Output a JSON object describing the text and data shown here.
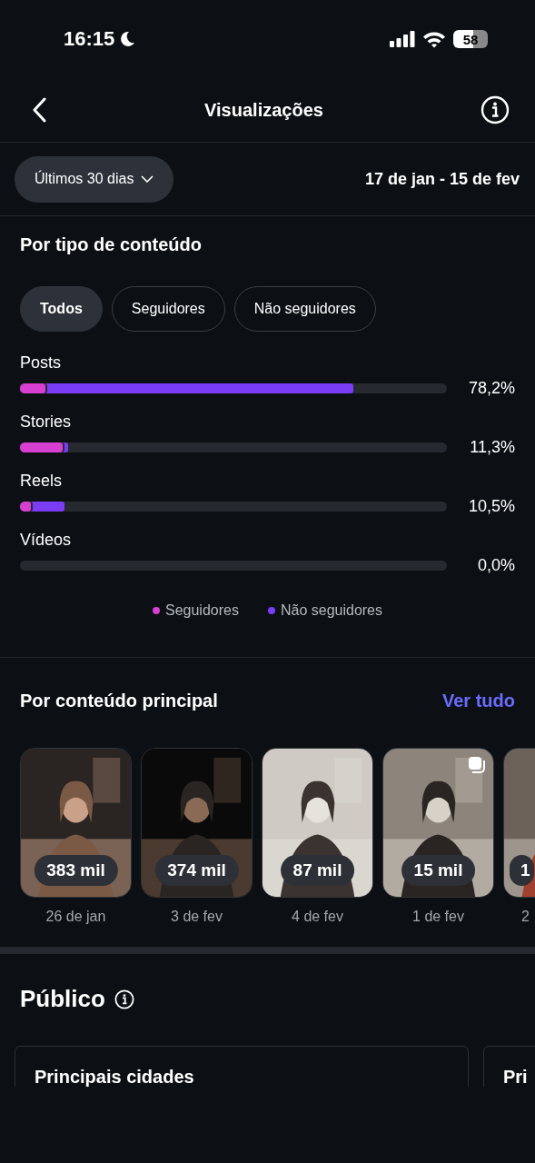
{
  "status_bar": {
    "time": "16:15",
    "battery": "58"
  },
  "header": {
    "title": "Visualizações"
  },
  "filter": {
    "period": "Últimos 30 dias",
    "range": "17 de jan - 15 de fev"
  },
  "content_type": {
    "title": "Por tipo de conteúdo",
    "chips": [
      {
        "label": "Todos",
        "selected": true
      },
      {
        "label": "Seguidores",
        "selected": false
      },
      {
        "label": "Não seguidores",
        "selected": false
      }
    ],
    "bars": [
      {
        "label": "Posts",
        "value": "78,2%",
        "level": 0.78,
        "followers": {
          "level": 0.06
        }
      },
      {
        "label": "Stories",
        "value": "11,3%",
        "level": 0.113,
        "followers": {
          "level": 0.1
        }
      },
      {
        "label": "Reels",
        "value": "10,5%",
        "level": 0.105,
        "followers": {
          "level": 0.025
        }
      },
      {
        "label": "Vídeos",
        "value": "0,0%"
      }
    ],
    "legend": [
      {
        "label": "Seguidores",
        "color": "#d63fd0"
      },
      {
        "label": "Não seguidores",
        "color": "#7a3cf5"
      }
    ]
  },
  "top_content": {
    "title": "Por conteúdo principal",
    "link": "Ver tudo",
    "items": [
      {
        "count": "383 mil",
        "date": "26 de jan",
        "carousel": false
      },
      {
        "count": "374 mil",
        "date": "3 de fev",
        "carousel": false
      },
      {
        "count": "87 mil",
        "date": "4 de fev",
        "carousel": false
      },
      {
        "count": "15 mil",
        "date": "1 de fev",
        "carousel": true
      },
      {
        "count": "1",
        "date": "2",
        "carousel": false
      }
    ]
  },
  "audience": {
    "title": "Público",
    "cards": [
      {
        "title": "Principais cidades"
      },
      {
        "title": "Pri"
      }
    ]
  }
}
